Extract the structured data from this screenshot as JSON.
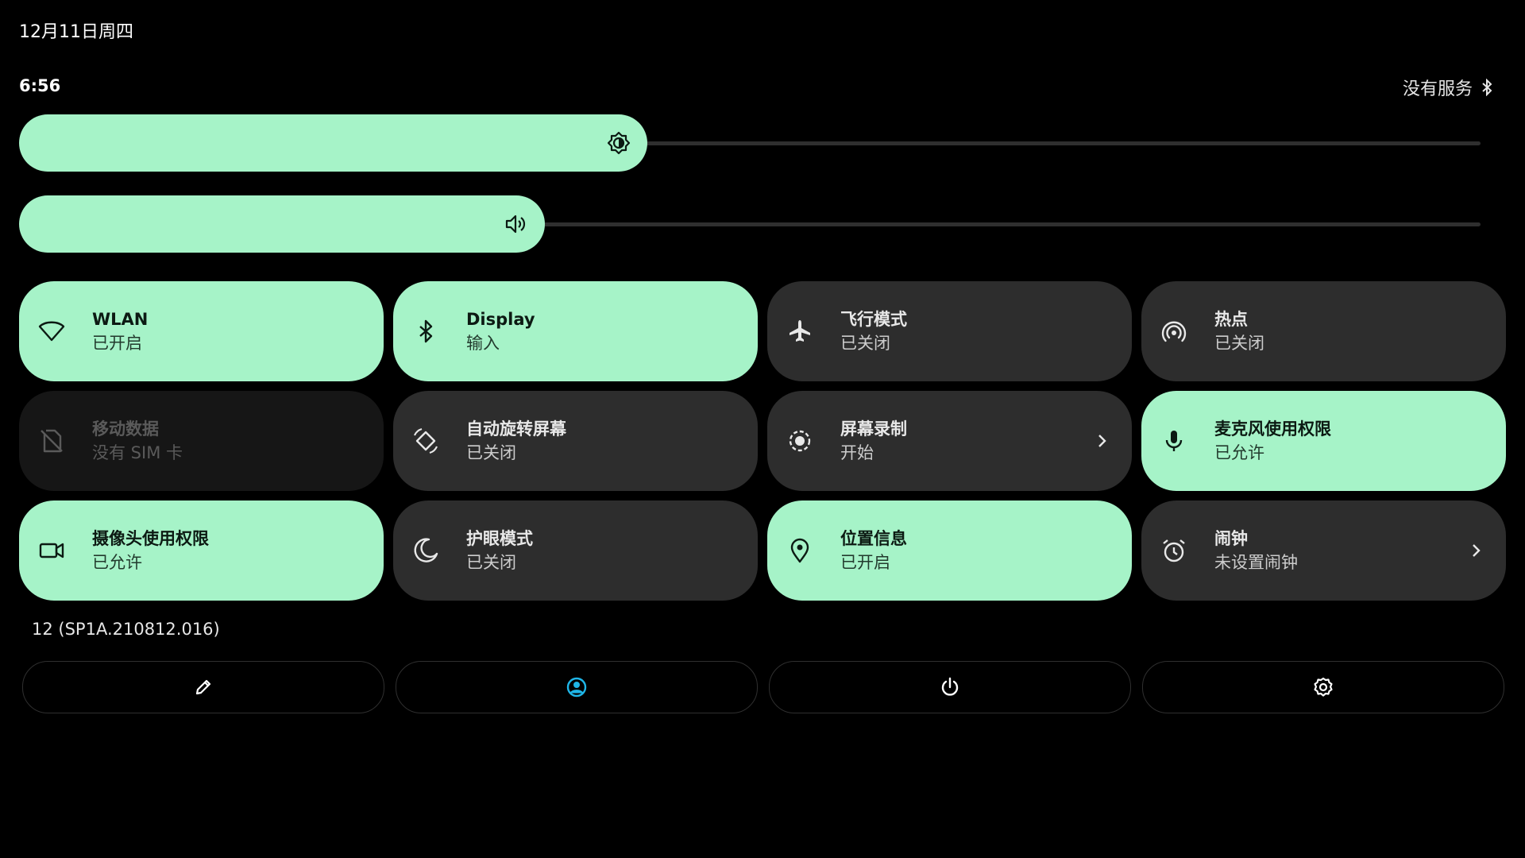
{
  "status": {
    "date": "12月11日周四",
    "time": "6:56",
    "network": "没有服务"
  },
  "sliders": {
    "brightness": {
      "level": 0.43,
      "icon": "brightness-icon"
    },
    "volume": {
      "level": 0.36,
      "icon": "volume-icon"
    }
  },
  "tiles": [
    {
      "title": "WLAN",
      "subtitle": "已开启",
      "state": "on",
      "icon": "wifi-icon"
    },
    {
      "title": "Display",
      "subtitle": "输入",
      "state": "on",
      "icon": "bluetooth-icon"
    },
    {
      "title": "飞行模式",
      "subtitle": "已关闭",
      "state": "off",
      "icon": "airplane-icon"
    },
    {
      "title": "热点",
      "subtitle": "已关闭",
      "state": "off",
      "icon": "hotspot-icon"
    },
    {
      "title": "移动数据",
      "subtitle": "没有 SIM 卡",
      "state": "disabled",
      "icon": "no-sim-icon"
    },
    {
      "title": "自动旋转屏幕",
      "subtitle": "已关闭",
      "state": "off",
      "icon": "rotate-icon"
    },
    {
      "title": "屏幕录制",
      "subtitle": "开始",
      "state": "off",
      "icon": "screen-record-icon",
      "chevron": true
    },
    {
      "title": "麦克风使用权限",
      "subtitle": "已允许",
      "state": "on",
      "icon": "microphone-icon"
    },
    {
      "title": "摄像头使用权限",
      "subtitle": "已允许",
      "state": "on",
      "icon": "camera-icon"
    },
    {
      "title": "护眼模式",
      "subtitle": "已关闭",
      "state": "off",
      "icon": "moon-icon"
    },
    {
      "title": "位置信息",
      "subtitle": "已开启",
      "state": "on",
      "icon": "location-icon"
    },
    {
      "title": "闹钟",
      "subtitle": "未设置闹钟",
      "state": "off",
      "icon": "alarm-icon",
      "chevron": true
    }
  ],
  "build": "12 (SP1A.210812.016)",
  "footer": [
    {
      "icon": "edit-icon"
    },
    {
      "icon": "user-icon"
    },
    {
      "icon": "power-icon"
    },
    {
      "icon": "settings-icon"
    }
  ],
  "colors": {
    "accent": "#a6f3c8",
    "tile_off": "#2d2d2d",
    "tile_disabled": "#161616",
    "user_icon": "#1fb6e8"
  }
}
